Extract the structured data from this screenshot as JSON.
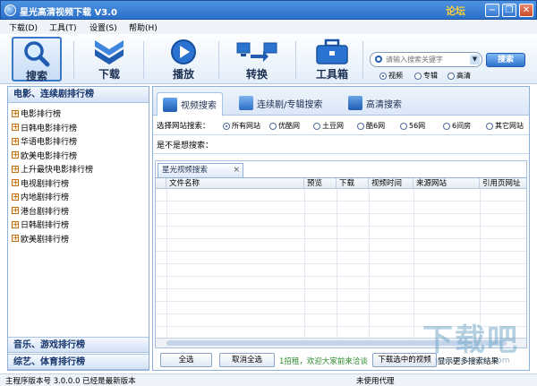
{
  "window": {
    "title": "星光高清视频下载  V3.0",
    "forum_link": "论坛",
    "min_glyph": "−",
    "restore_glyph": "❐",
    "close_glyph": "✕"
  },
  "menu": [
    "下载(D)",
    "工具(T)",
    "设置(S)",
    "帮助(H)"
  ],
  "toolbar": {
    "search_label": "搜索",
    "download_label": "下载",
    "play_label": "播放",
    "convert_label": "转换",
    "toolbox_label": "工具箱"
  },
  "search": {
    "placeholder": "请输入搜索关键字",
    "go_label": "搜索",
    "types": [
      "视频",
      "专辑",
      "高清"
    ],
    "selected_type": "视频"
  },
  "left_panel": {
    "heading_movies": "电影、连续剧排行榜",
    "items": [
      "电影排行榜",
      "日韩电影排行榜",
      "华语电影排行榜",
      "欧美电影排行榜",
      "上升最快电影排行榜",
      "电视剧排行榜",
      "内地剧排行榜",
      "港台剧排行榜",
      "日韩剧排行榜",
      "欧美剧排行榜"
    ],
    "heading_music": "音乐、游戏排行榜",
    "heading_variety": "综艺、体育排行榜"
  },
  "tabs": {
    "video_search": "视频搜索",
    "series_search": "连续剧/专辑搜索",
    "hd_search": "高清搜索"
  },
  "site_filter": {
    "label": "选择网站搜索：",
    "options": [
      "所有网站",
      "优酷网",
      "土豆网",
      "酷6网",
      "56网",
      "6间房",
      "其它网站"
    ],
    "selected": "所有网站"
  },
  "hint_label": "是不是想搜索：",
  "results": {
    "tab_label": "星光视频搜索",
    "tab_close": "×",
    "columns": [
      "文件名称",
      "预览",
      "下载",
      "视频时间",
      "来源网站",
      "引用页网址"
    ]
  },
  "bottom": {
    "select_all": "全选",
    "deselect_all": "取消全选",
    "ad_text": "1招租，欢迎大家前来洽谈",
    "download_selected": "下载选中的视频",
    "show_more": "显示更多搜索结果"
  },
  "status": {
    "version": "主程序版本号  3.0.0.0   已经是最新版本",
    "proxy": "未使用代理"
  },
  "watermark": {
    "big": "下载吧",
    "small": "www.xiazaiba.com"
  },
  "colors": {
    "titlebar": "#2a6fc8",
    "accent": "#1f5cb2",
    "panel_border": "#8fb0d8"
  }
}
